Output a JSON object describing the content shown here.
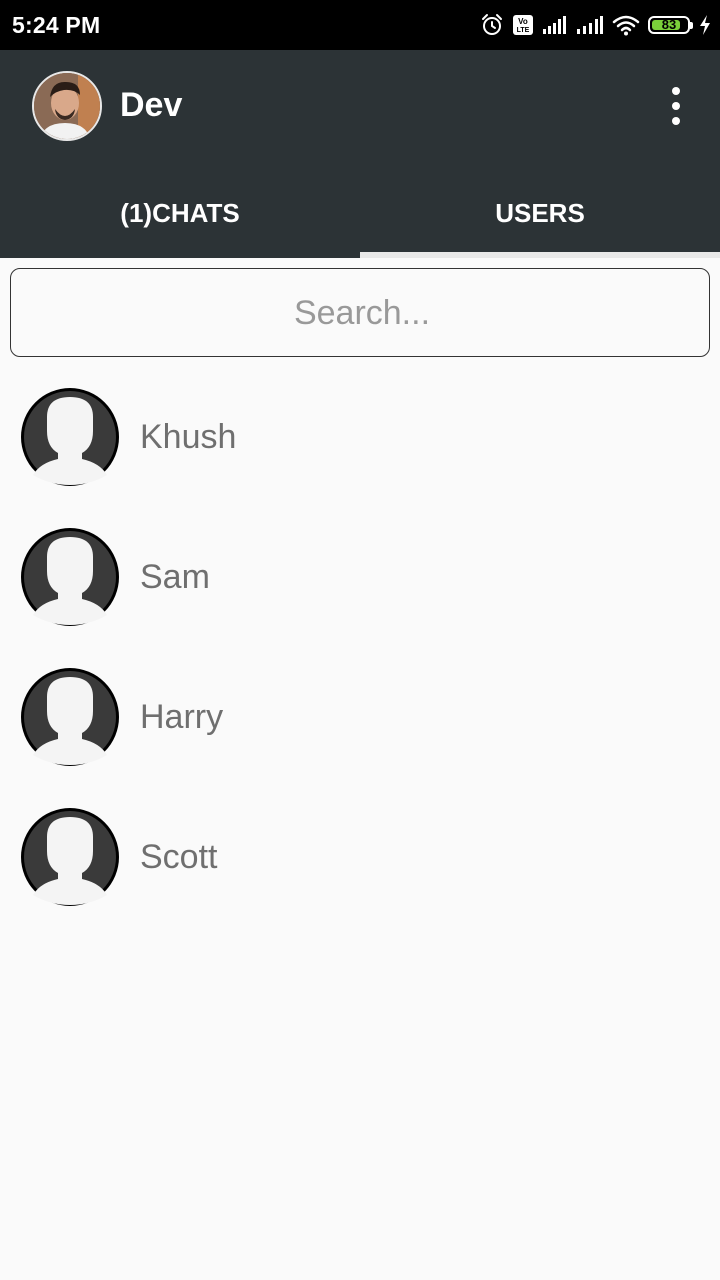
{
  "status_bar": {
    "time": "5:24 PM",
    "battery": "83",
    "battery_level": 0.83,
    "icons": [
      "alarm-icon",
      "volte-icon",
      "signal-icon",
      "signal-icon",
      "wifi-icon",
      "battery-icon",
      "charging-icon"
    ]
  },
  "app_bar": {
    "title": "Dev",
    "menu_icon": "more-vert-icon"
  },
  "tabs": [
    {
      "label": "(1)CHATS",
      "selected": false
    },
    {
      "label": "USERS",
      "selected": true
    }
  ],
  "search": {
    "placeholder": "Search...",
    "value": ""
  },
  "users": [
    {
      "name": "Khush"
    },
    {
      "name": "Sam"
    },
    {
      "name": "Harry"
    },
    {
      "name": "Scott"
    }
  ],
  "colors": {
    "app_bar": "#2c3336",
    "background": "#fafafa",
    "tab_indicator": "#e8e8e8",
    "battery_fill": "#7bd13a"
  }
}
